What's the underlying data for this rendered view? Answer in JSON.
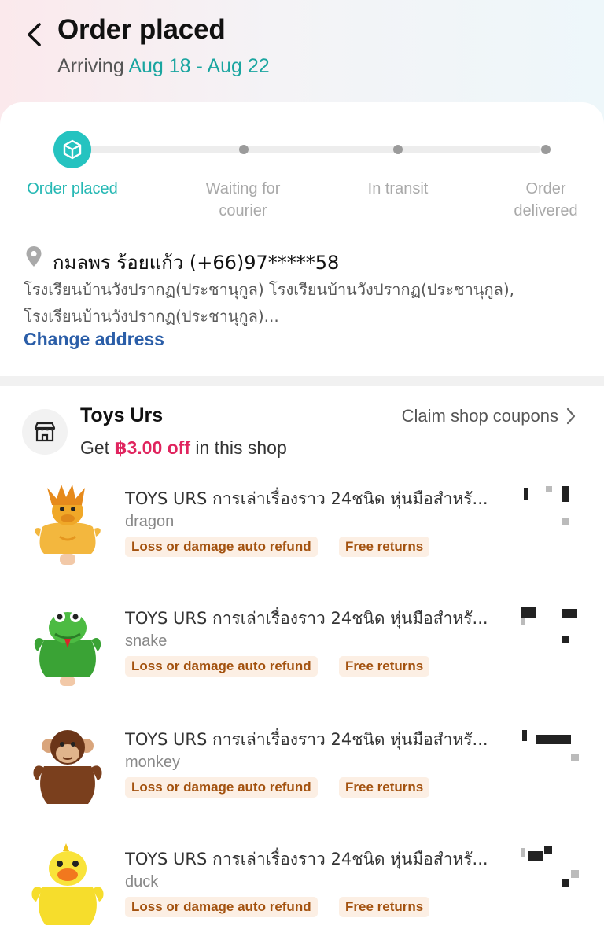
{
  "header": {
    "title": "Order placed",
    "arriving_label": "Arriving",
    "arriving_dates": "Aug 18 - Aug 22"
  },
  "progress": {
    "steps": [
      {
        "label": "Order placed",
        "state": "active"
      },
      {
        "label": "Waiting for\ncourier",
        "state": "pending"
      },
      {
        "label": "In transit",
        "state": "pending"
      },
      {
        "label": "Order\ndelivered",
        "state": "pending"
      }
    ],
    "active_color": "#25c3c0"
  },
  "address": {
    "name_phone": "กมลพร ร้อยแก้ว (+66)97*****58",
    "line1": "โรงเรียนบ้านวังปรากฏ(ประชานุกูล) โรงเรียนบ้านวังปรากฏ(ประชานุกูล),",
    "line2": "โรงเรียนบ้านวังปรากฏ(ประชานุกูล)...",
    "change_label": "Change address"
  },
  "shop": {
    "name": "Toys Urs",
    "coupon_prefix": "Get",
    "coupon_amount": "฿3.00 off",
    "coupon_suffix": "in this shop",
    "claim_label": "Claim shop coupons"
  },
  "items": [
    {
      "title": "TOYS URS การเล่าเรื่องราว 24ชนิด หุ่นมือสำหรั...",
      "variant": "dragon",
      "badge_refund": "Loss or damage auto refund",
      "badge_returns": "Free returns",
      "icon": "dragon-puppet"
    },
    {
      "title": "TOYS URS การเล่าเรื่องราว 24ชนิด หุ่นมือสำหรั...",
      "variant": "snake",
      "badge_refund": "Loss or damage auto refund",
      "badge_returns": "Free returns",
      "icon": "snake-puppet"
    },
    {
      "title": "TOYS URS การเล่าเรื่องราว 24ชนิด หุ่นมือสำหรั...",
      "variant": "monkey",
      "badge_refund": "Loss or damage auto refund",
      "badge_returns": "Free returns",
      "icon": "monkey-puppet"
    },
    {
      "title": "TOYS URS การเล่าเรื่องราว 24ชนิด หุ่นมือสำหรั...",
      "variant": "duck",
      "badge_refund": "Loss or damage auto refund",
      "badge_returns": "Free returns",
      "icon": "duck-puppet"
    }
  ],
  "colors": {
    "accent_teal": "#25c3c0",
    "link_blue": "#2b5ea8",
    "coupon_pink": "#e0245e",
    "badge_bg": "#fcefe4",
    "badge_text": "#a3520f"
  }
}
